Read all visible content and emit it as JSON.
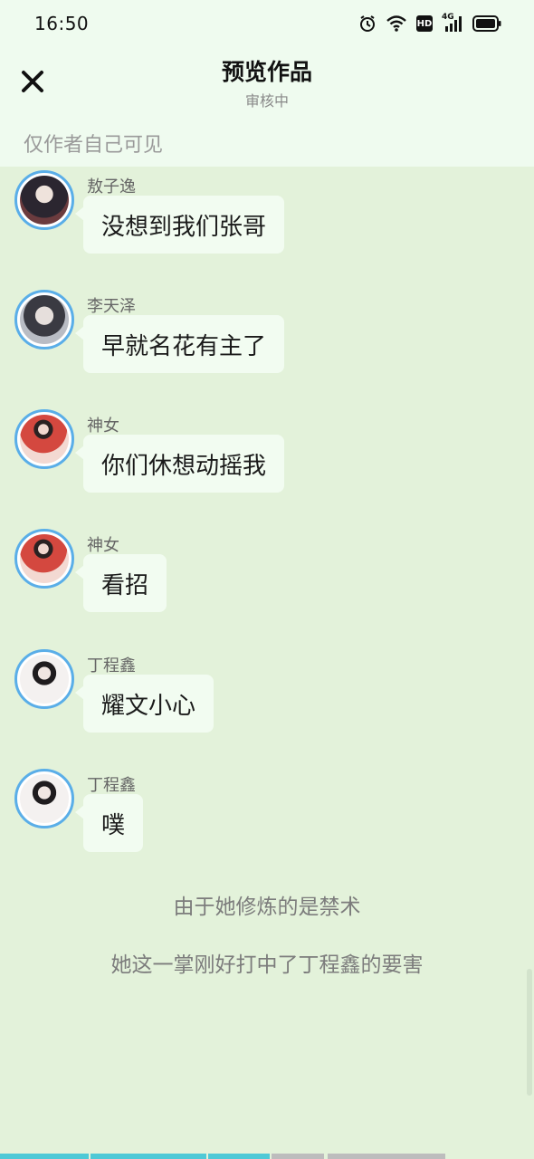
{
  "status_bar": {
    "time": "16:50",
    "icons": [
      "alarm-icon",
      "wifi-icon",
      "hd-icon",
      "signal-4g-icon",
      "battery-icon"
    ],
    "hd_label": "HD",
    "network_label": "4G"
  },
  "header": {
    "title": "预览作品",
    "subtitle": "审核中",
    "visibility_note": "仅作者自己可见",
    "close_icon": "close-icon"
  },
  "messages": [
    {
      "sender": "敖子逸",
      "text": "没想到我们张哥",
      "avatar_color": "#3b3340"
    },
    {
      "sender": "李天泽",
      "text": "早就名花有主了",
      "avatar_color": "#6c6f78"
    },
    {
      "sender": "神女",
      "text": "你们休想动摇我",
      "avatar_color": "#c8463f"
    },
    {
      "sender": "神女",
      "text": "看招",
      "avatar_color": "#c8463f"
    },
    {
      "sender": "丁程鑫",
      "text": "耀文小心",
      "avatar_color": "#e9e4e3"
    },
    {
      "sender": "丁程鑫",
      "text": "噗",
      "avatar_color": "#e9e4e3"
    }
  ],
  "narration": [
    "由于她修炼的是禁术",
    "她这一掌刚好打中了丁程鑫的要害"
  ],
  "colors": {
    "page_bg": "#e3f2da",
    "header_bg": "#effbef",
    "bubble_bg": "#f2fcf1",
    "avatar_ring": "#5aaee8",
    "progress_active": "#4ec9d6",
    "progress_inactive": "#bdbdbd"
  }
}
